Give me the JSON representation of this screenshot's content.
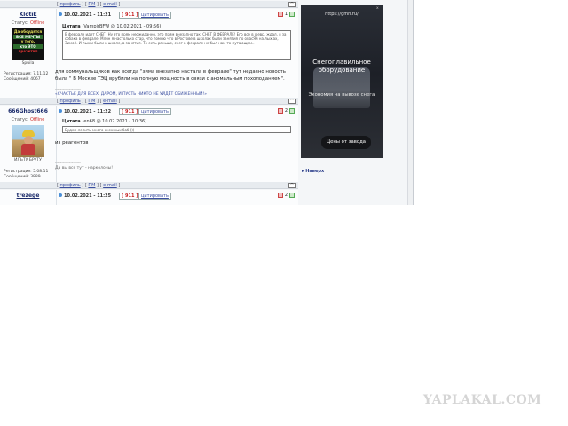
{
  "nav_links": {
    "profile": "профиль",
    "pm": "ПМ",
    "email": "e-mail",
    "up": "^"
  },
  "posts": [
    {
      "username": "Klotik",
      "status_label": "Статус:",
      "status_value": "Offline",
      "avatar_text": [
        "Да обсудятся",
        "ВСЕ МЕЧТЫ",
        "у того,",
        "кто ЭТО",
        "прочитал"
      ],
      "avatar_caption": "Spuila",
      "reg_label": "Регистрация:",
      "reg_value": "7.11.12",
      "posts_label": "Сообщений:",
      "posts_value": "4067",
      "date": "10.02.2021 - 11:21",
      "number": "911",
      "quote_link": "цитировать",
      "vote_count": "1",
      "quote_title": "Цитата",
      "quote_meta": "(VampirBFW @ 10.02.2021 - 09:56)",
      "quote_text": "В феврале идет СНЕГ! Ну это прям неожиданно, это прям внезапно так, СНЕГ В ФЕВРАЛЕ! Его все в февр. ждал, я за собака в феврале. Млин я настолько стар, что помню что в Ростове в школах были занятия по опасЯй на лыжах, Зимой. И лыжи были в школе, в занятия. То есть раньше, снег в феврале не был нам то путающим..",
      "body": "для коммунальщиков как всегда \"зима внезапно настала в феврале\" тут недавно новость была \" В Москве ТЭЦ врубили на полную мощность в связи с аномальным похолоданием\".",
      "separator": "--------------------",
      "signature": "«СЧАСТЬЕ ДЛЯ ВСЕХ, ДАРОМ, И ПУСТЬ НИКТО НЕ УЙДЁТ ОБИЖЕННЫЙ!»"
    },
    {
      "username": "666Ghost666",
      "status_label": "Статус:",
      "status_value": "Offline",
      "avatar_caption": "ИЛЬТУ БРУТУ",
      "reg_label": "Регистрация:",
      "reg_value": "5.08.11",
      "posts_label": "Сообщений:",
      "posts_value": "3889",
      "date": "10.02.2021 - 11:22",
      "number": "911",
      "quote_link": "цитировать",
      "vote_count": "2",
      "quote_title": "Цитата",
      "quote_meta": "(en68 @ 10.02.2021 - 10:36)",
      "quote_text": "Будем лепить много снежных баб )))",
      "body": "из реагентов",
      "separator": "--------------------",
      "signature": "Да вы все тут - нарколоны!"
    },
    {
      "username": "trezege",
      "date": "10.02.2021 - 11:25",
      "number": "911",
      "quote_link": "цитировать",
      "vote_count": "2"
    }
  ],
  "ad": {
    "url": "https://gmh.ru/",
    "title": "Снегоплавильное оборудование",
    "subtitle": "Экономия на вывозе снега",
    "button": "Цены от завода",
    "close": "x"
  },
  "back_link": "▸ Наверх",
  "watermark": "YAPLAKAL.COM"
}
